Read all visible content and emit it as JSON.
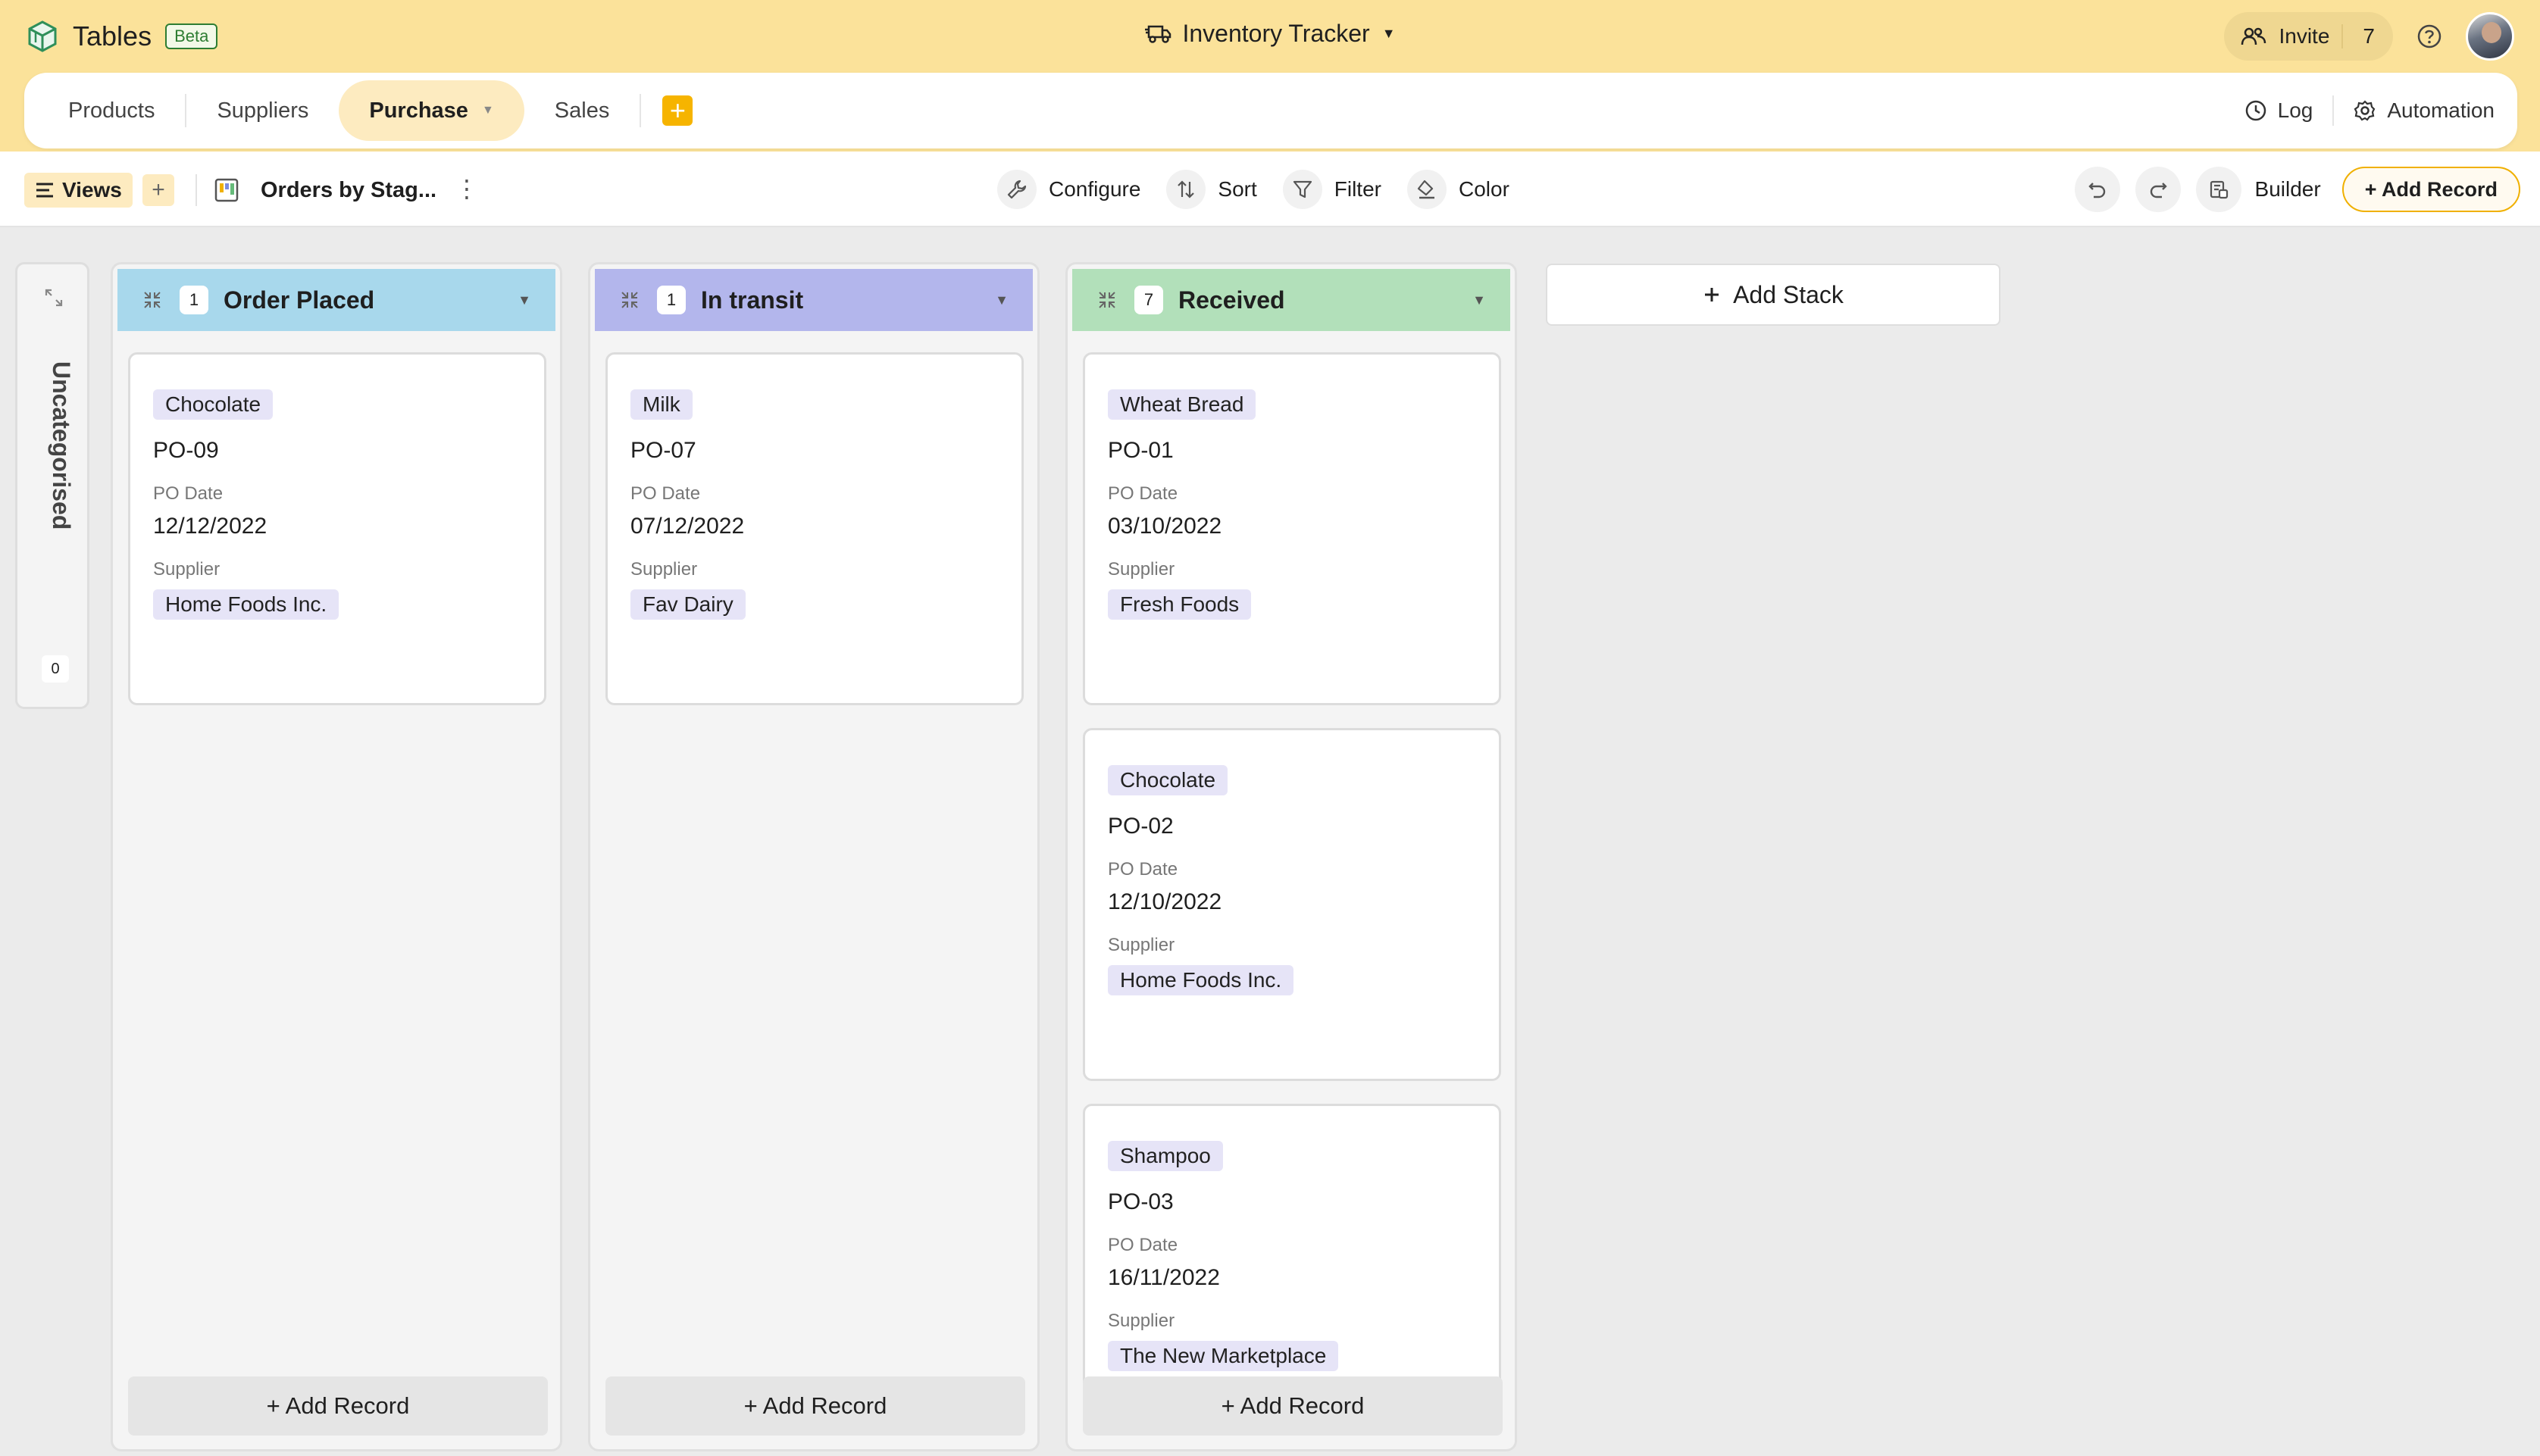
{
  "app": {
    "name": "Tables",
    "badge": "Beta"
  },
  "document": {
    "title": "Inventory Tracker"
  },
  "header": {
    "invite_label": "Invite",
    "invite_count": "7"
  },
  "tabs": [
    {
      "label": "Products"
    },
    {
      "label": "Suppliers"
    },
    {
      "label": "Purchase",
      "active": true
    },
    {
      "label": "Sales"
    }
  ],
  "tab_actions": {
    "log_label": "Log",
    "automation_label": "Automation"
  },
  "toolbar": {
    "views_label": "Views",
    "view_name": "Orders by Stag...",
    "configure_label": "Configure",
    "sort_label": "Sort",
    "filter_label": "Filter",
    "color_label": "Color",
    "builder_label": "Builder",
    "add_record_label": "+ Add Record"
  },
  "board": {
    "uncategorised": {
      "label": "Uncategorised",
      "count": "0"
    },
    "field_labels": {
      "date": "PO Date",
      "supplier": "Supplier"
    },
    "add_record_label": "+ Add Record",
    "add_stack_label": "Add Stack",
    "stacks": [
      {
        "title": "Order Placed",
        "count": "1",
        "color": "#a8d8ec",
        "cards": [
          {
            "product": "Chocolate",
            "po": "PO-09",
            "date": "12/12/2022",
            "supplier": "Home Foods Inc."
          }
        ]
      },
      {
        "title": "In transit",
        "count": "1",
        "color": "#b3b6ec",
        "cards": [
          {
            "product": "Milk",
            "po": "PO-07",
            "date": "07/12/2022",
            "supplier": "Fav Dairy"
          }
        ]
      },
      {
        "title": "Received",
        "count": "7",
        "color": "#b2e0ba",
        "cards": [
          {
            "product": "Wheat Bread",
            "po": "PO-01",
            "date": "03/10/2022",
            "supplier": "Fresh Foods"
          },
          {
            "product": "Chocolate",
            "po": "PO-02",
            "date": "12/10/2022",
            "supplier": "Home Foods Inc."
          },
          {
            "product": "Shampoo",
            "po": "PO-03",
            "date": "16/11/2022",
            "supplier": "The New Marketplace"
          }
        ]
      }
    ]
  },
  "colors": {
    "header_bg": "#fbe29a",
    "accent": "#f6b400",
    "chip_bg": "#e6e4f7"
  }
}
